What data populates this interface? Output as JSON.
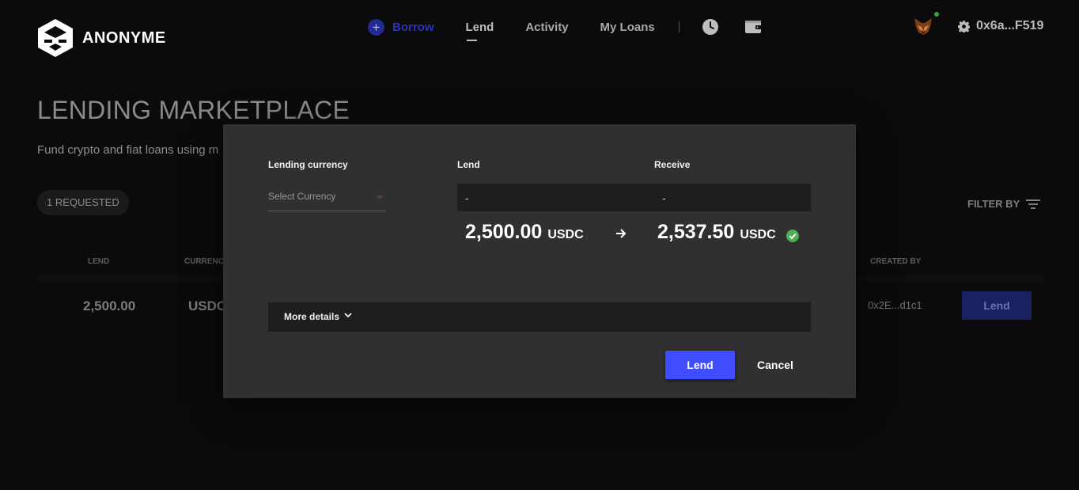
{
  "brand": {
    "name": "ANONYME"
  },
  "nav": {
    "borrow": "Borrow",
    "lend": "Lend",
    "activity": "Activity",
    "my_loans": "My Loans",
    "icons": [
      "clock-icon",
      "wallet-icon"
    ]
  },
  "account": {
    "address": "0x6a...F519",
    "wallet": "metamask-fox-icon",
    "status_color": "#3ca43c"
  },
  "page": {
    "title": "LENDING MARKETPLACE",
    "subtitle": "Fund crypto and fiat loans using m",
    "requested_chip": "1 REQUESTED",
    "filter_label": "FILTER BY"
  },
  "table": {
    "headers": {
      "lend": "LEND",
      "currency": "CURRENC",
      "created_by": "CREATED BY"
    },
    "rows": [
      {
        "lend": "2,500.00",
        "currency": "USDC",
        "created_by": "0x2E...d1c1",
        "action": "Lend"
      }
    ]
  },
  "modal": {
    "lending_currency_label": "Lending currency",
    "select_placeholder": "Select Currency",
    "lend_label": "Lend",
    "receive_label": "Receive",
    "lend_field_value": "-",
    "receive_field_value": "-",
    "lend_amount": "2,500.00",
    "lend_currency": "USDC",
    "receive_amount": "2,537.50",
    "receive_currency": "USDC",
    "more_details": "More details",
    "lend_button": "Lend",
    "cancel_button": "Cancel",
    "accent_color": "#3f4cff",
    "success_color": "#4caf50"
  }
}
